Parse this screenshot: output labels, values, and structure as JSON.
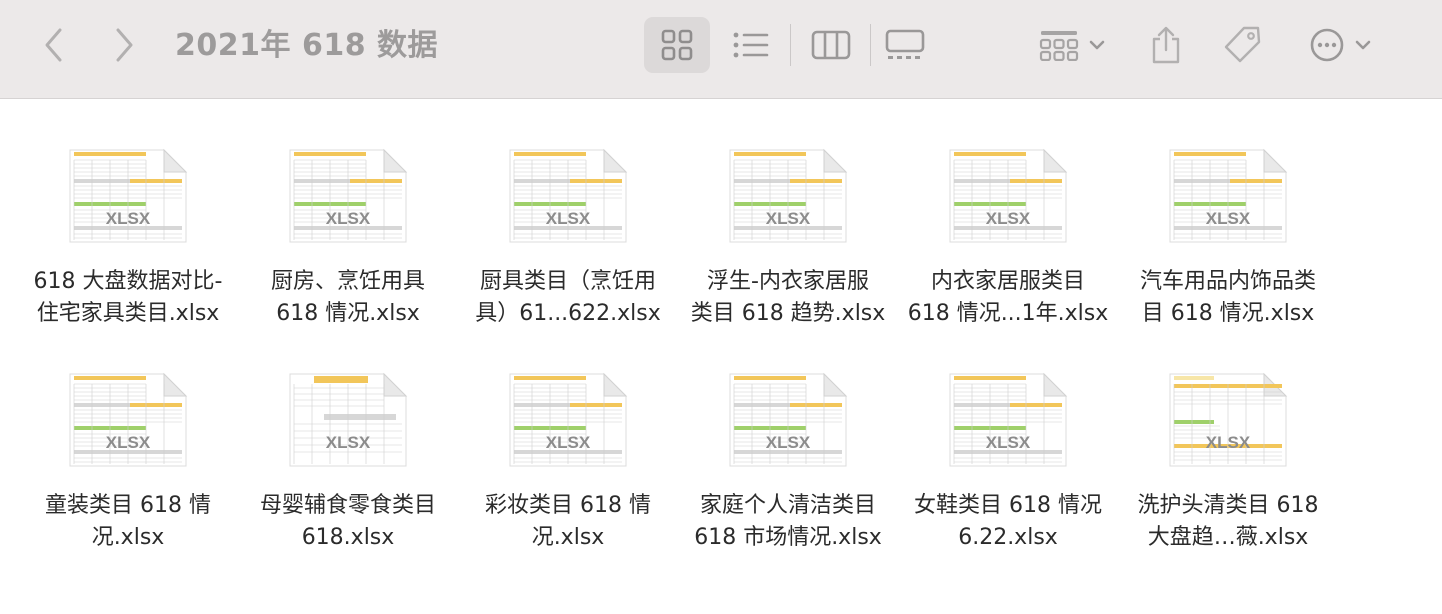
{
  "window": {
    "title": "2021年 618 数据"
  },
  "toolbar": {
    "back_icon": "chevron-left-icon",
    "forward_icon": "chevron-right-icon",
    "views": [
      "icon-view",
      "list-view",
      "column-view",
      "gallery-view"
    ],
    "selected_view": "icon-view"
  },
  "files": [
    {
      "line1": "618 大盘数据对比-",
      "line2": "住宅家具类目.xlsx",
      "thumb_label": "XLSX"
    },
    {
      "line1": "厨房、烹饪用具",
      "line2": "618 情况.xlsx",
      "thumb_label": "XLSX"
    },
    {
      "line1": "厨具类目（烹饪用",
      "line2": "具）61...622.xlsx",
      "thumb_label": "XLSX"
    },
    {
      "line1": "浮生-内衣家居服",
      "line2": "类目 618 趋势.xlsx",
      "thumb_label": "XLSX"
    },
    {
      "line1": "内衣家居服类目",
      "line2": "618 情况...1年.xlsx",
      "thumb_label": "XLSX"
    },
    {
      "line1": "汽车用品内饰品类",
      "line2": "目 618 情况.xlsx",
      "thumb_label": "XLSX"
    },
    {
      "line1": "童装类目 618 情",
      "line2": "况.xlsx",
      "thumb_label": "XLSX"
    },
    {
      "line1": "母婴辅食零食类目",
      "line2": "618.xlsx",
      "thumb_label": "XLSX"
    },
    {
      "line1": "彩妆类目 618 情",
      "line2": "况.xlsx",
      "thumb_label": "XLSX"
    },
    {
      "line1": "家庭个人清洁类目",
      "line2": "618 市场情况.xlsx",
      "thumb_label": "XLSX"
    },
    {
      "line1": "女鞋类目 618 情况",
      "line2": "6.22.xlsx",
      "thumb_label": "XLSX"
    },
    {
      "line1": "洗护头清类目 618",
      "line2": "大盘趋…薇.xlsx",
      "thumb_label": "XLSX"
    }
  ],
  "colors": {
    "sheet_yellow": "#f2c65a",
    "sheet_green": "#9fd06a",
    "sheet_grey": "#d7d7d7"
  }
}
